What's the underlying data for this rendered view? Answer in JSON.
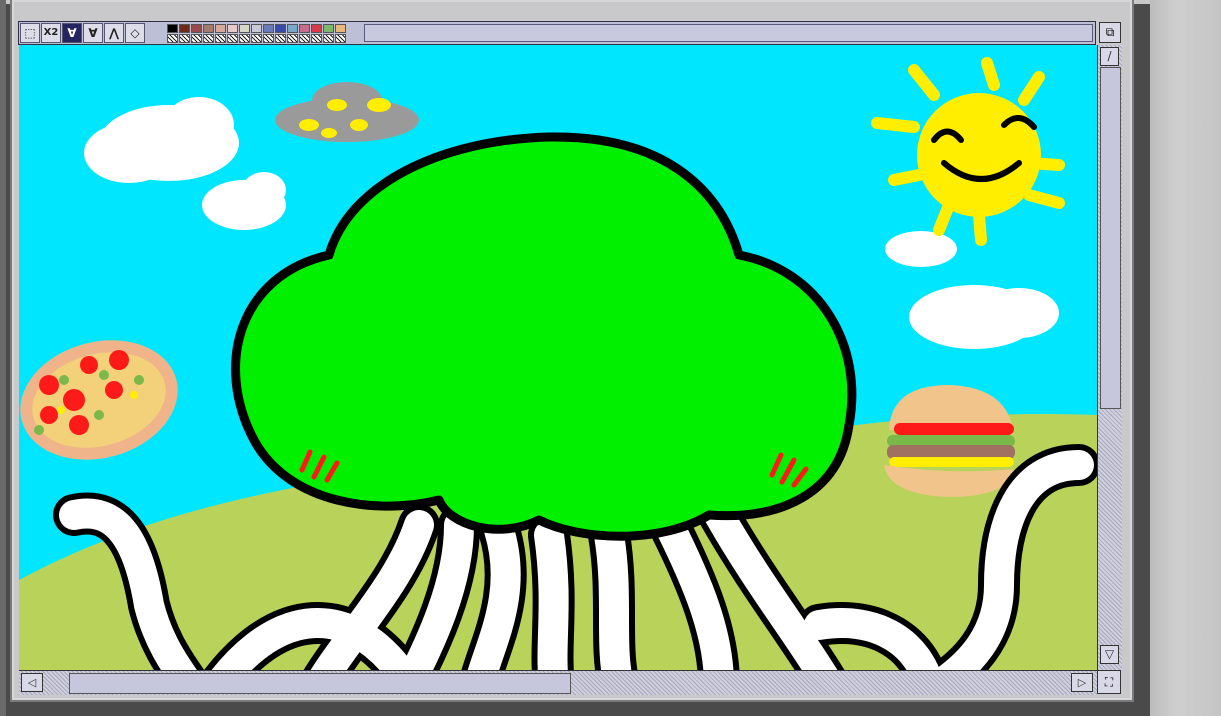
{
  "toolbar": {
    "tools": [
      {
        "icon": "select-rect-icon",
        "glyph": "⬚",
        "active": false
      },
      {
        "icon": "zoom-x2-icon",
        "glyph": "X2",
        "active": false
      },
      {
        "icon": "pen-filled-icon",
        "glyph": "∀",
        "active": true
      },
      {
        "icon": "pen-outline-icon",
        "glyph": "∀",
        "active": false
      },
      {
        "icon": "line-tool-icon",
        "glyph": "⋀",
        "active": false
      },
      {
        "icon": "fill-bucket-icon",
        "glyph": "◇",
        "active": false
      }
    ],
    "colors": [
      "#000000",
      "#6b2a1a",
      "#9a4a4a",
      "#a47a6a",
      "#d8a898",
      "#e8c8c8",
      "#d8d8c8",
      "#c8c8d8",
      "#6a7ab8",
      "#3a4aa8",
      "#7aa8c8",
      "#c86a8a",
      "#d83a4a",
      "#7ab86a",
      "#e8b87a"
    ]
  },
  "scrollbars": {
    "up_glyph": "/",
    "down_glyph": "▽",
    "left_glyph": "◁",
    "right_glyph": "▷",
    "corner_glyph": "⛶",
    "window_glyph": "⧉"
  },
  "palette": {
    "sky": "#00e6ff",
    "grass": "#b8d25a",
    "tree": "#00f000",
    "outline": "#000000",
    "sun": "#ffee00",
    "cloud": "#ffffff",
    "ufo": "#9a9a9a",
    "accent_red": "#ff1a1a"
  }
}
